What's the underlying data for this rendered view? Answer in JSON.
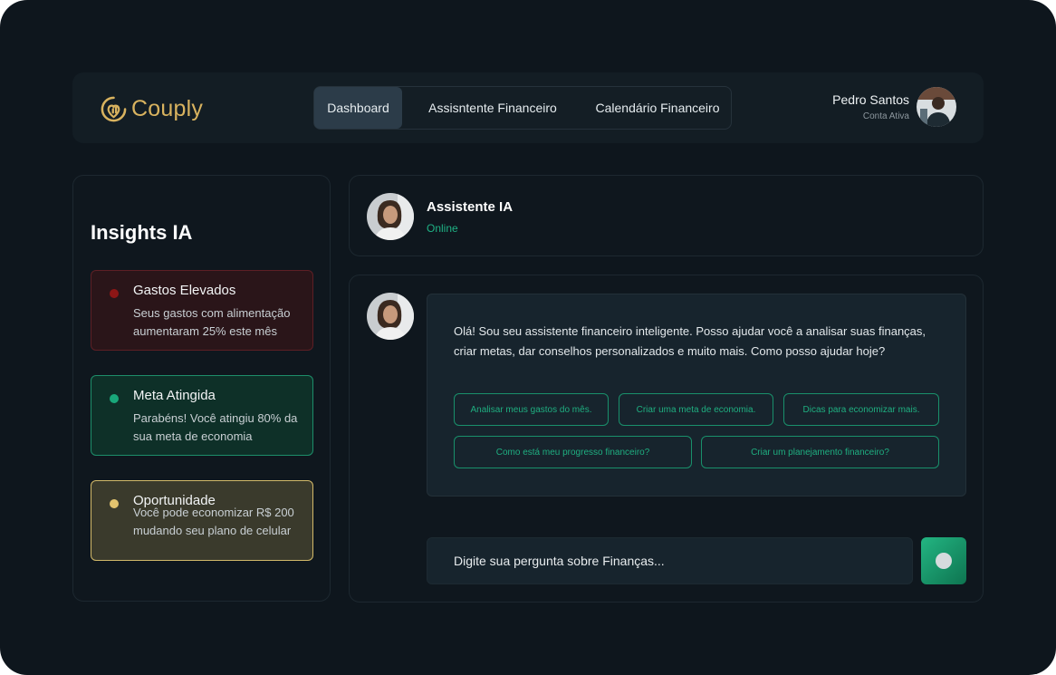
{
  "app": {
    "name": "Couply"
  },
  "nav": {
    "tabs": [
      {
        "label": "Dashboard",
        "active": true
      },
      {
        "label": "Assisntente Financeiro",
        "active": false
      },
      {
        "label": "Calendário Financeiro",
        "active": false
      }
    ]
  },
  "user": {
    "name": "Pedro Santos",
    "status": "Conta Ativa"
  },
  "insights": {
    "title": "Insights IA",
    "cards": [
      {
        "title": "Gastos Elevados",
        "text": "Seus gastos com alimentação aumentaram 25% este mês",
        "color": "#8d1616"
      },
      {
        "title": "Meta Atingida",
        "text": "Parabéns! Você atingiu 80% da sua meta de economia",
        "color": "#19a77a"
      },
      {
        "title": "Oportunidade",
        "text": "Você pode economizar R$ 200 mudando seu plano de celular",
        "color": "#e2c36e"
      }
    ]
  },
  "assistant": {
    "name": "Assistente IA",
    "status": "Online"
  },
  "chat": {
    "message": "Olá! Sou seu assistente financeiro inteligente. Posso ajudar você a analisar suas finanças, criar metas, dar conselhos personalizados e muito mais. Como posso ajudar hoje?",
    "suggestions": [
      "Analisar meus gastos do mês.",
      "Criar uma meta de economia.",
      "Dicas para economizar mais.",
      "Como está meu progresso financeiro?",
      "Criar um planejamento financeiro?"
    ],
    "input_placeholder": "Digite sua pergunta sobre Finanças..."
  },
  "colors": {
    "accent": "#1fae80",
    "brand": "#d9b35f",
    "background": "#0e161d"
  }
}
